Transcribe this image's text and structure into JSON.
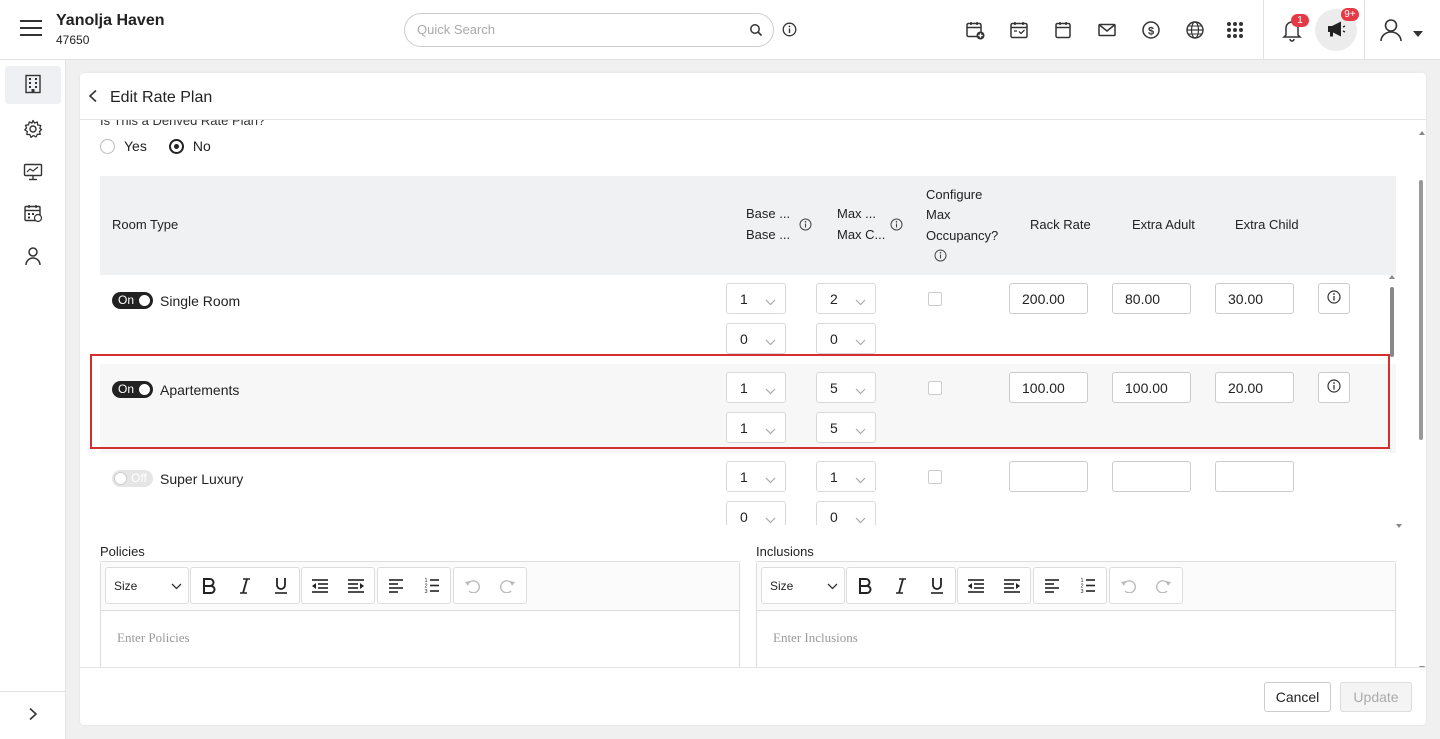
{
  "header": {
    "property_name": "Yanolja Haven",
    "property_id": "47650",
    "search_placeholder": "Quick Search",
    "notifications_badge": "1",
    "announcements_badge": "9+"
  },
  "page": {
    "title": "Edit Rate Plan",
    "derived_question": "Is This a Derived Rate Plan?",
    "derived_options": [
      "Yes",
      "No"
    ],
    "derived_selected": "No"
  },
  "table": {
    "headers": {
      "room_type": "Room Type",
      "base_1": "Base ...",
      "base_2": "Base ...",
      "max_1": "Max ...",
      "max_2": "Max C...",
      "configure_1": "Configure",
      "configure_2": "Max",
      "configure_3": "Occupancy?",
      "rack_rate": "Rack Rate",
      "extra_adult": "Extra Adult",
      "extra_child": "Extra Child"
    },
    "rows": [
      {
        "status": "On",
        "name": "Single Room",
        "base_a": "1",
        "base_b": "0",
        "max_a": "2",
        "max_b": "0",
        "rack": "200.00",
        "adult": "80.00",
        "child": "30.00"
      },
      {
        "status": "On",
        "name": "Apartements",
        "base_a": "1",
        "base_b": "1",
        "max_a": "5",
        "max_b": "5",
        "rack": "100.00",
        "adult": "100.00",
        "child": "20.00"
      },
      {
        "status": "Off",
        "name": "Super Luxury",
        "base_a": "1",
        "base_b": "0",
        "max_a": "1",
        "max_b": "0",
        "rack": "",
        "adult": "",
        "child": ""
      }
    ]
  },
  "policies": {
    "label": "Policies",
    "placeholder": "Enter Policies",
    "size_label": "Size"
  },
  "inclusions": {
    "label": "Inclusions",
    "placeholder": "Enter Inclusions",
    "size_label": "Size"
  },
  "footer": {
    "cancel": "Cancel",
    "update": "Update"
  },
  "colors": {
    "highlight": "#d32f2f",
    "badge": "#e53945",
    "toggle_on": "#222222"
  }
}
